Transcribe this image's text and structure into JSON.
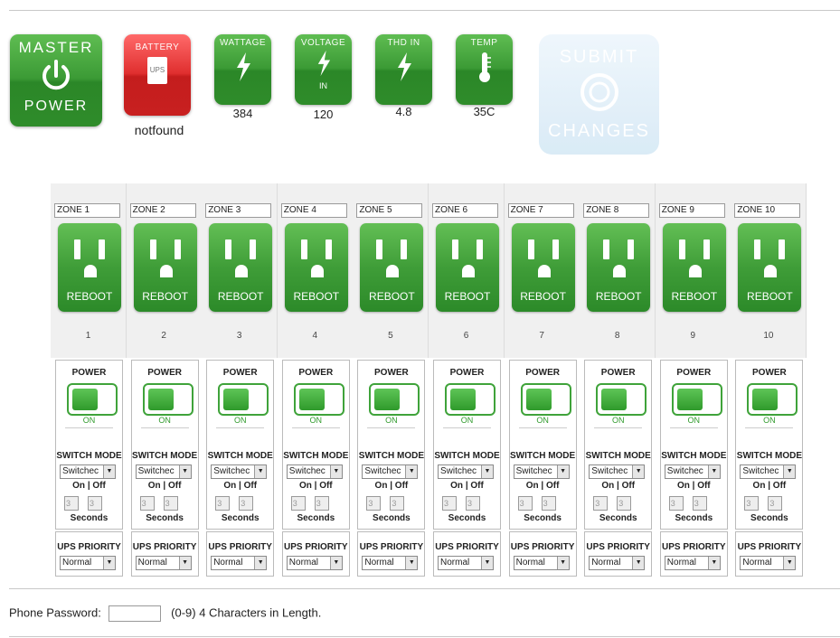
{
  "status": {
    "master": {
      "top": "MASTER",
      "bottom": "POWER"
    },
    "battery": {
      "label": "BATTERY",
      "badge": "UPS",
      "value": "notfound"
    },
    "wattage": {
      "label": "WATTAGE",
      "value": "384"
    },
    "voltage": {
      "label": "VOLTAGE",
      "sub": "IN",
      "value": "120"
    },
    "thd": {
      "label": "THD IN",
      "value": "4.8"
    },
    "temp": {
      "label": "TEMP",
      "value": "35C"
    },
    "submit": {
      "top": "SUBMIT",
      "bottom": "CHANGES"
    }
  },
  "zones": [
    {
      "name": "ZONE 1",
      "num": "1"
    },
    {
      "name": "ZONE 2",
      "num": "2"
    },
    {
      "name": "ZONE 3",
      "num": "3"
    },
    {
      "name": "ZONE 4",
      "num": "4"
    },
    {
      "name": "ZONE 5",
      "num": "5"
    },
    {
      "name": "ZONE 6",
      "num": "6"
    },
    {
      "name": "ZONE 7",
      "num": "7"
    },
    {
      "name": "ZONE 8",
      "num": "8"
    },
    {
      "name": "ZONE 9",
      "num": "9"
    },
    {
      "name": "ZONE 10",
      "num": "10"
    }
  ],
  "zone_common": {
    "reboot": "REBOOT",
    "power": "POWER",
    "on": "ON",
    "switch_mode": "SWITCH MODE",
    "switch_value": "Switchec",
    "on_off": "On | Off",
    "on_sec": "3",
    "off_sec": "3",
    "seconds": "Seconds",
    "ups_priority": "UPS PRIORITY",
    "priority_value": "Normal"
  },
  "phone": {
    "label": "Phone Password:",
    "hint": "(0-9) 4 Characters in Length."
  }
}
